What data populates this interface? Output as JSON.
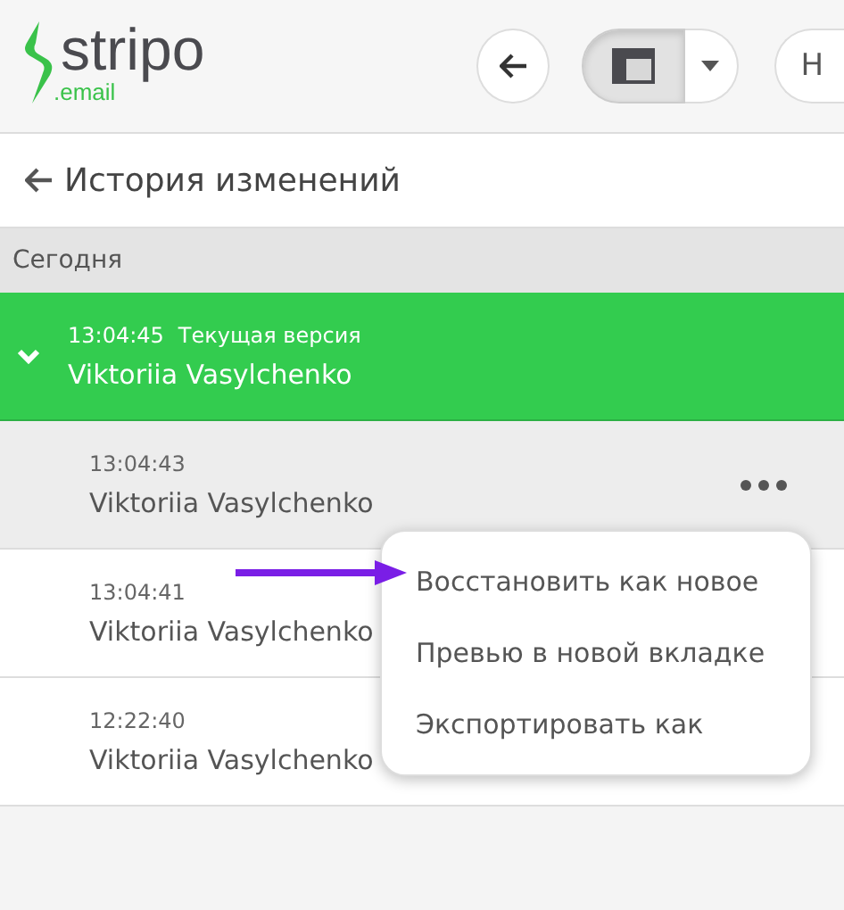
{
  "logo": {
    "name": "stripo",
    "sub": ".email"
  },
  "toolbar": {
    "partial_button": "Н"
  },
  "panel": {
    "title": "История изменений",
    "group": "Сегодня"
  },
  "versions": [
    {
      "time": "13:04:45",
      "tag": "Текущая версия",
      "author": "Viktoriia Vasylchenko",
      "selected": true,
      "expanded": true,
      "hovered": false
    },
    {
      "time": "13:04:43",
      "author": "Viktoriia Vasylchenko",
      "selected": false,
      "expanded": false,
      "hovered": true
    },
    {
      "time": "13:04:41",
      "author": "Viktoriia Vasylchenko",
      "selected": false,
      "expanded": false,
      "hovered": false
    },
    {
      "time": "12:22:40",
      "author": "Viktoriia Vasylchenko",
      "selected": false,
      "expanded": false,
      "hovered": false
    }
  ],
  "context_menu": {
    "items": [
      {
        "label": "Восстановить как новое",
        "highlighted": true
      },
      {
        "label": "Превью в новой вкладке",
        "highlighted": false
      },
      {
        "label": "Экспортировать как",
        "highlighted": false
      }
    ]
  }
}
